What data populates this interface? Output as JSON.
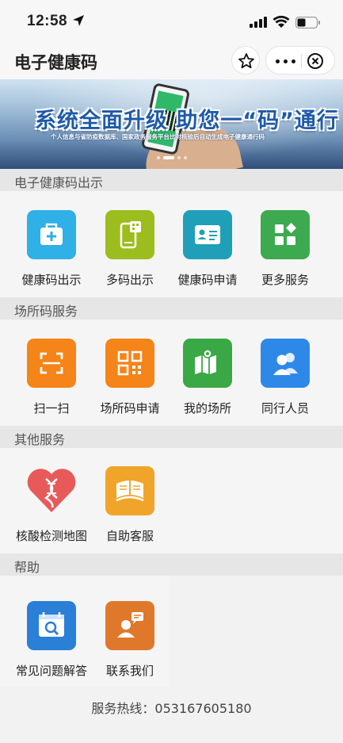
{
  "status_bar": {
    "time": "12:58"
  },
  "nav": {
    "title": "电子健康码"
  },
  "banner": {
    "headline": "系统全面升级 助您一“码”通行",
    "subline": "个人信息与省防疫数据库、国家政务服务平台比对核验后自动生成电子健康通行码"
  },
  "sections": [
    {
      "title": "电子健康码出示",
      "items": [
        {
          "label": "健康码出示",
          "icon": "medical-kit-icon",
          "color": "#2fb0e6"
        },
        {
          "label": "多码出示",
          "icon": "phone-qr-icon",
          "color": "#9cbd1e"
        },
        {
          "label": "健康码申请",
          "icon": "id-card-icon",
          "color": "#1f9fb8"
        },
        {
          "label": "更多服务",
          "icon": "apps-grid-icon",
          "color": "#3daa4f"
        }
      ]
    },
    {
      "title": "场所码服务",
      "items": [
        {
          "label": "扫一扫",
          "icon": "scan-icon",
          "color": "#f58419"
        },
        {
          "label": "场所码申请",
          "icon": "qr-code-icon",
          "color": "#f58419"
        },
        {
          "label": "我的场所",
          "icon": "map-icon",
          "color": "#3aa844"
        },
        {
          "label": "同行人员",
          "icon": "people-icon",
          "color": "#2e88e8"
        }
      ]
    },
    {
      "title": "其他服务",
      "items": [
        {
          "label": "核酸检测地图",
          "icon": "dna-heart-icon",
          "color": "#e85a5a"
        },
        {
          "label": "自助客服",
          "icon": "book-stack-icon",
          "color": "#f0a52a"
        }
      ]
    },
    {
      "title": "帮助",
      "items": [
        {
          "label": "常见问题解答",
          "icon": "calendar-search-icon",
          "color": "#2a7fd6"
        },
        {
          "label": "联系我们",
          "icon": "contact-chat-icon",
          "color": "#e0782c"
        }
      ]
    }
  ],
  "hotline": "服务热线：053167605180"
}
